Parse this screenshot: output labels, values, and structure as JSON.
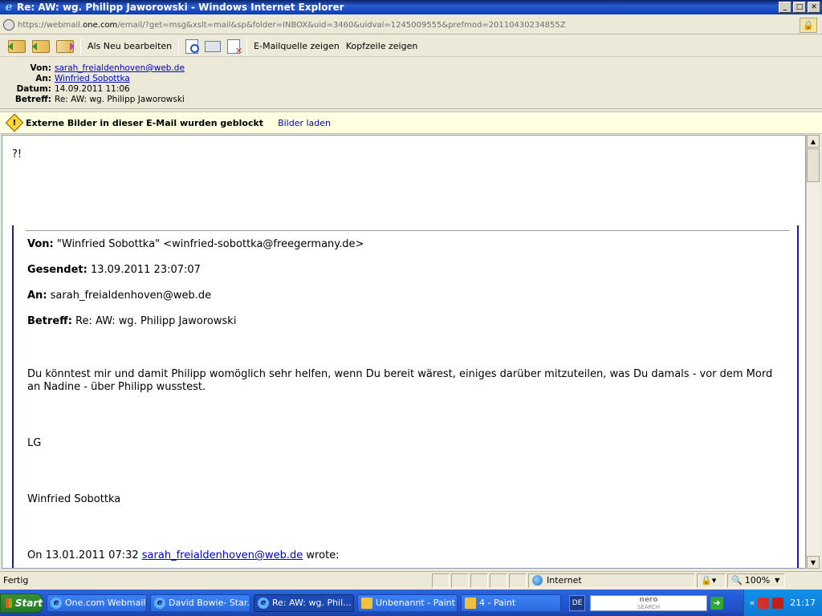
{
  "window": {
    "title": "Re: AW: wg. Philipp Jaworowski - Windows Internet Explorer",
    "controls": [
      "_",
      "□",
      "✕"
    ]
  },
  "address": {
    "scheme": "https://",
    "host": "webmail.",
    "domain": "one.com",
    "path": "/email/?get=msg&xslt=mail&sp&folder=INBOX&uid=3460&uidval=1245009555&prefmod=20110430234855Z"
  },
  "toolbar": {
    "mark_new_label": "Als Neu bearbeiten",
    "source_label": "E-Mailquelle zeigen",
    "headers_label": "Kopfzeile zeigen"
  },
  "header": {
    "from_key": "Von:",
    "from_val": "sarah_freialdenhoven@web.de",
    "to_key": "An:",
    "to_val": "Winfried Sobottka",
    "date_key": "Datum:",
    "date_val": "14.09.2011 11:06",
    "subject_key": "Betreff:",
    "subject_val": "Re: AW: wg. Philipp Jaworowski"
  },
  "warning": {
    "text": "Externe Bilder in dieser E-Mail wurden geblockt",
    "link": "Bilder laden"
  },
  "body": {
    "top_text": "?!",
    "quoted": {
      "from_key": "Von:",
      "from_val": "\"Winfried Sobottka\" <winfried-sobottka@freegermany.de>",
      "sent_key": "Gesendet:",
      "sent_val": "13.09.2011 23:07:07",
      "to_key": "An:",
      "to_val": "sarah_freialdenhoven@web.de",
      "subject_key": "Betreff:",
      "subject_val": "Re: AW: wg. Philipp Jaworowski",
      "para_1": "Du könntest mir und damit Philipp womöglich sehr helfen, wenn Du bereit wärest, einiges darüber mitzuteilen, was Du damals - vor dem Mord",
      "para_2": "an Nadine - über Philipp wusstest.",
      "greeting": "LG",
      "signature": "Winfried Sobottka",
      "on_prefix": "On 13.01.2011 07:32",
      "on_link": "sarah_freialdenhoven@web.de",
      "on_suffix": "wrote:"
    }
  },
  "status": {
    "left": "Fertig",
    "zone": "Internet",
    "zoom": "100%"
  },
  "taskbar": {
    "start": "Start",
    "tasks": [
      {
        "label": "One.com Webmail..."
      },
      {
        "label": "David Bowie- Star..."
      },
      {
        "label": "Re: AW: wg. Phil..."
      },
      {
        "label": "Unbenannt - Paint"
      },
      {
        "label": "4 - Paint"
      }
    ],
    "lang": "DE",
    "search_brand": "nero",
    "search_sub": "SEARCH",
    "clock": "21:17"
  },
  "colors": {
    "title_bar": "#0a3fb8",
    "link": "#0000cc",
    "quote_bar": "#1a1aa8",
    "warning_bg": "#ffffe1",
    "taskbar": "#245edb"
  }
}
